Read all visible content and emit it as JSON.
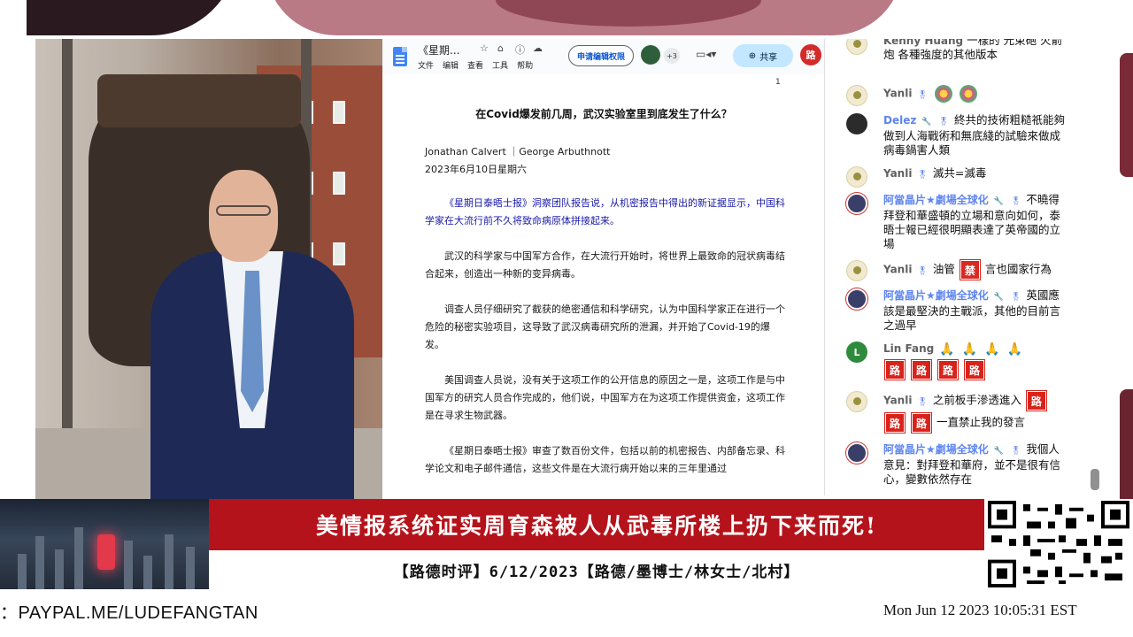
{
  "doc": {
    "title": "《星期...",
    "menu": [
      "文件",
      "编辑",
      "查看",
      "工具",
      "帮助"
    ],
    "request_edit": "申请编辑权限",
    "viewers_more": "+3",
    "share": "共享",
    "owner_avatar": "路",
    "page_number": "1",
    "headline": "在Covid爆发前几周，武汉实验室里到底发生了什么？",
    "authors": "Jonathan Calvert ｜George Arbuthnott",
    "date": "2023年6月10日星期六",
    "lead": "《星期日泰晤士报》洞察团队报告说，从机密报告中得出的新证据显示，中国科学家在大流行前不久将致命病原体拼接起来。",
    "p1": "武汉的科学家与中国军方合作，在大流行开始时，将世界上最致命的冠状病毒结合起来，创造出一种新的变异病毒。",
    "p2": "调查人员仔细研究了截获的绝密通信和科学研究，认为中国科学家正在进行一个危险的秘密实验项目，这导致了武汉病毒研究所的泄漏，并开始了Covid-19的爆发。",
    "p3": "美国调查人员说，没有关于这项工作的公开信息的原因之一是，这项工作是与中国军方的研究人员合作完成的，他们说，中国军方在为这项工作提供资金，这项工作是在寻求生物武器。",
    "p4": "《星期日泰晤士报》审查了数百份文件，包括以前的机密报告、内部备忘录、科学论文和电子邮件通信，这些文件是在大流行病开始以来的三年里通过"
  },
  "chat": {
    "m0": {
      "name": "Kenny Huang",
      "text": "一樣的 光束砲 火箭炮 各種強度的其他版本"
    },
    "m1": {
      "name": "Yanli"
    },
    "m2": {
      "name": "Delez",
      "text": "終共的技術粗糙祇能夠做到人海戰術和無底綫的試驗來做成病毒鍋害人類"
    },
    "m3": {
      "name": "Yanli",
      "text": "滅共=滅毒"
    },
    "m4": {
      "name": "阿當晶片★劇場全球化",
      "text": "不曉得拜登和華盛頓的立場和意向如何，泰晤士報已經很明顯表達了英帝國的立場"
    },
    "m5": {
      "name": "Yanli",
      "text_a": "油管",
      "jin": "禁",
      "text_b": "言也國家行為"
    },
    "m6": {
      "name": "阿當晶片★劇場全球化",
      "text": "英國應該是最堅決的主戰派，其他的目前言之過早"
    },
    "m7": {
      "name": "Lin Fang",
      "avatar": "L",
      "ro": "路"
    },
    "m8": {
      "name": "Yanli",
      "text_a": "之前板手滲透進入",
      "text_b": "一直禁止我的發言",
      "ro": "路"
    },
    "m9": {
      "name": "阿當晶片★劇場全球化",
      "text": "我個人意見：對拜登和華府，並不是很有信心，變數依然存在"
    }
  },
  "banner": {
    "headline": "美情报系统证实周育森被人从武毒所楼上扔下来而死!",
    "subline": "【路德时评】6/12/2023【路德/墨博士/林女士/北村】"
  },
  "footer": {
    "paypal": "：PAYPAL.ME/LUDEFANGTAN",
    "clock": "Mon Jun 12 2023 10:05:31 EST"
  },
  "colors": {
    "banner_red": "#b5131b",
    "share_blue": "#c2e7ff",
    "chat_name_blue": "#5e84f1",
    "ro_red": "#d8231b"
  }
}
